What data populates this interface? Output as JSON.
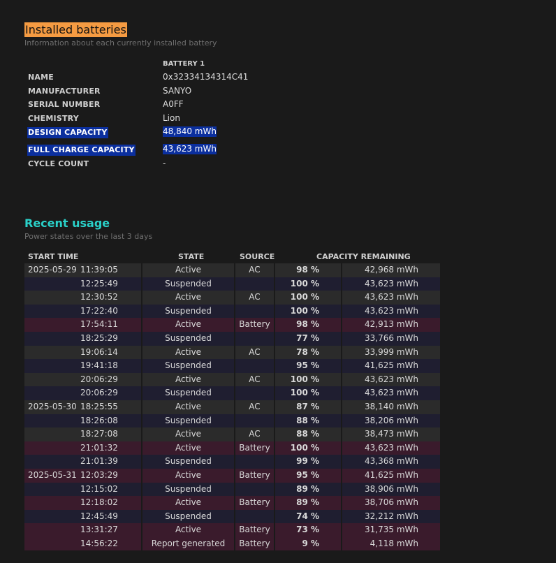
{
  "installed": {
    "title": "Installed batteries",
    "subtitle": "Information about each currently installed battery",
    "column_header": "BATTERY 1",
    "fields": [
      {
        "label": "NAME",
        "value": "0x32334134314C41"
      },
      {
        "label": "MANUFACTURER",
        "value": "SANYO"
      },
      {
        "label": "SERIAL NUMBER",
        "value": "A0FF"
      },
      {
        "label": "CHEMISTRY",
        "value": "Lion"
      },
      {
        "label": "DESIGN CAPACITY",
        "value": "48,840 mWh",
        "selected": true
      },
      {
        "label": "FULL CHARGE CAPACITY",
        "value": "43,623 mWh",
        "selected": true
      },
      {
        "label": "CYCLE COUNT",
        "value": "-"
      }
    ],
    "selection_color": "#0b2f9e",
    "title_highlight_color": "#f59b42"
  },
  "recent": {
    "title": "Recent usage",
    "subtitle": "Power states over the last 3 days",
    "headers": {
      "start_time": "START TIME",
      "state": "STATE",
      "source": "SOURCE",
      "capacity": "CAPACITY REMAINING"
    },
    "accent_color": "#2ad1c9",
    "rows": [
      {
        "date": "2025-05-29",
        "time": "11:39:05",
        "state": "Active",
        "source": "AC",
        "pct": "98 %",
        "mwh": "42,968 mWh"
      },
      {
        "date": "",
        "time": "12:25:49",
        "state": "Suspended",
        "source": "",
        "pct": "100 %",
        "mwh": "43,623 mWh"
      },
      {
        "date": "",
        "time": "12:30:52",
        "state": "Active",
        "source": "AC",
        "pct": "100 %",
        "mwh": "43,623 mWh"
      },
      {
        "date": "",
        "time": "17:22:40",
        "state": "Suspended",
        "source": "",
        "pct": "100 %",
        "mwh": "43,623 mWh"
      },
      {
        "date": "",
        "time": "17:54:11",
        "state": "Active",
        "source": "Battery",
        "pct": "98 %",
        "mwh": "42,913 mWh"
      },
      {
        "date": "",
        "time": "18:25:29",
        "state": "Suspended",
        "source": "",
        "pct": "77 %",
        "mwh": "33,766 mWh"
      },
      {
        "date": "",
        "time": "19:06:14",
        "state": "Active",
        "source": "AC",
        "pct": "78 %",
        "mwh": "33,999 mWh"
      },
      {
        "date": "",
        "time": "19:41:18",
        "state": "Suspended",
        "source": "",
        "pct": "95 %",
        "mwh": "41,625 mWh"
      },
      {
        "date": "",
        "time": "20:06:29",
        "state": "Active",
        "source": "AC",
        "pct": "100 %",
        "mwh": "43,623 mWh"
      },
      {
        "date": "",
        "time": "20:06:29",
        "state": "Suspended",
        "source": "",
        "pct": "100 %",
        "mwh": "43,623 mWh"
      },
      {
        "date": "2025-05-30",
        "time": "18:25:55",
        "state": "Active",
        "source": "AC",
        "pct": "87 %",
        "mwh": "38,140 mWh"
      },
      {
        "date": "",
        "time": "18:26:08",
        "state": "Suspended",
        "source": "",
        "pct": "88 %",
        "mwh": "38,206 mWh"
      },
      {
        "date": "",
        "time": "18:27:08",
        "state": "Active",
        "source": "AC",
        "pct": "88 %",
        "mwh": "38,473 mWh"
      },
      {
        "date": "",
        "time": "21:01:32",
        "state": "Active",
        "source": "Battery",
        "pct": "100 %",
        "mwh": "43,623 mWh"
      },
      {
        "date": "",
        "time": "21:01:39",
        "state": "Suspended",
        "source": "",
        "pct": "99 %",
        "mwh": "43,368 mWh"
      },
      {
        "date": "2025-05-31",
        "time": "12:03:29",
        "state": "Active",
        "source": "Battery",
        "pct": "95 %",
        "mwh": "41,625 mWh"
      },
      {
        "date": "",
        "time": "12:15:02",
        "state": "Suspended",
        "source": "",
        "pct": "89 %",
        "mwh": "38,906 mWh"
      },
      {
        "date": "",
        "time": "12:18:02",
        "state": "Active",
        "source": "Battery",
        "pct": "89 %",
        "mwh": "38,706 mWh"
      },
      {
        "date": "",
        "time": "12:45:49",
        "state": "Suspended",
        "source": "",
        "pct": "74 %",
        "mwh": "32,212 mWh"
      },
      {
        "date": "",
        "time": "13:31:27",
        "state": "Active",
        "source": "Battery",
        "pct": "73 %",
        "mwh": "31,735 mWh"
      },
      {
        "date": "",
        "time": "14:56:22",
        "state": "Report generated",
        "source": "Battery",
        "pct": "9 %",
        "mwh": "4,118 mWh"
      }
    ]
  }
}
